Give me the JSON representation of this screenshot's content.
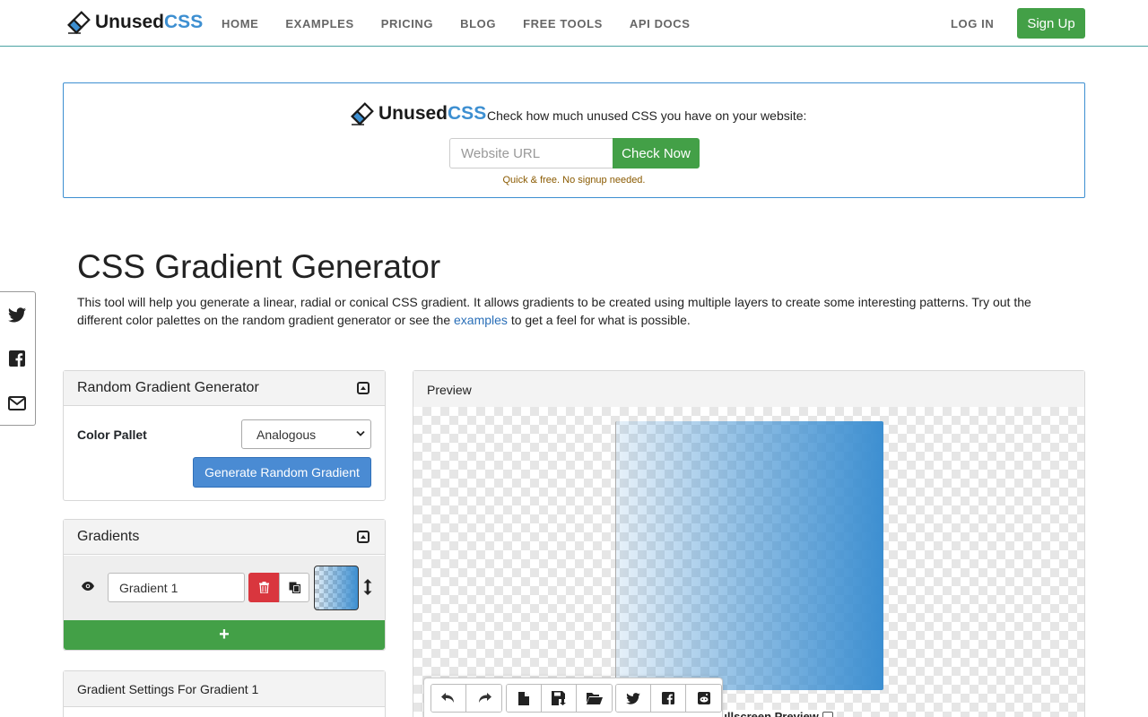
{
  "nav": {
    "logo_unused": "Unused",
    "logo_css": "CSS",
    "links": [
      "HOME",
      "EXAMPLES",
      "PRICING",
      "BLOG",
      "FREE TOOLS",
      "API DOCS"
    ],
    "login": "LOG IN",
    "signup": "Sign Up"
  },
  "promo": {
    "logo_unused": "Unused",
    "logo_css": "CSS",
    "text": "Check how much unused CSS you have on your website:",
    "url_placeholder": "Website URL",
    "check_button": "Check Now",
    "note": "Quick & free. No signup needed."
  },
  "social": [
    "twitter-icon",
    "facebook-icon",
    "email-icon"
  ],
  "page": {
    "title": "CSS Gradient Generator",
    "intro_before": "This tool will help you generate a linear, radial or conical CSS gradient. It allows gradients to be created using multiple layers to create some interesting patterns. Try out the different color palettes on the random gradient generator or see the ",
    "intro_link": "examples",
    "intro_after": " to get a feel for what is possible."
  },
  "random_panel": {
    "title": "Random Gradient Generator",
    "pallet_label": "Color Pallet",
    "pallet_value": "Analogous",
    "generate_button": "Generate Random Gradient"
  },
  "gradients_panel": {
    "title": "Gradients",
    "items": [
      {
        "name": "Gradient 1"
      }
    ],
    "add_symbol": "+"
  },
  "settings_panel": {
    "title": "Gradient Settings For Gradient 1"
  },
  "preview_panel": {
    "title": "Preview",
    "fullscreen_label": "Fullscreen Preview"
  },
  "toolbar": {
    "groups": [
      [
        "undo-icon",
        "redo-icon"
      ],
      [
        "new-file-icon",
        "save-icon",
        "open-folder-icon"
      ],
      [
        "twitter-icon",
        "facebook-icon",
        "reddit-icon"
      ]
    ]
  },
  "colors": {
    "accent_green": "#43a047",
    "accent_blue": "#4a8bd3",
    "danger_red": "#d9363e",
    "gradient_blue": "#3d8fd1",
    "link_blue": "#2a6fb8"
  }
}
